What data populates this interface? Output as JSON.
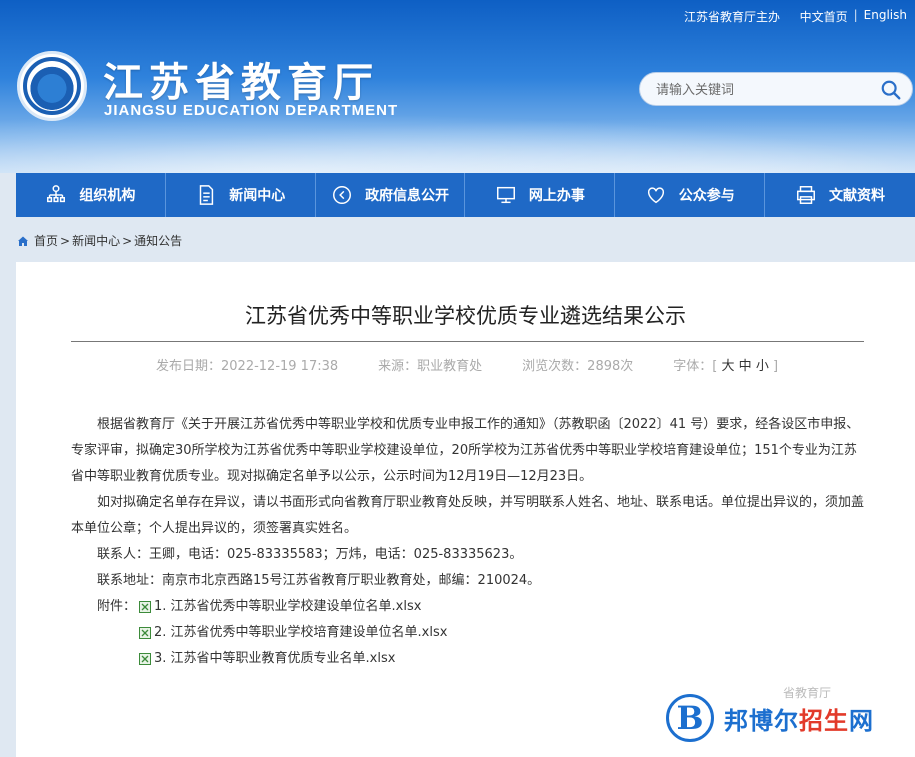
{
  "header": {
    "top_links": [
      "江苏省教育厅主办",
      "中文首页",
      "English"
    ],
    "site_name": "江苏省教育厅",
    "site_name_en": "JIANGSU EDUCATION DEPARTMENT",
    "search_placeholder": "请输入关键词"
  },
  "nav": [
    {
      "label": "组织机构",
      "icon": "org-chart-icon"
    },
    {
      "label": "新闻中心",
      "icon": "document-icon"
    },
    {
      "label": "政府信息公开",
      "icon": "info-icon"
    },
    {
      "label": "网上办事",
      "icon": "monitor-icon"
    },
    {
      "label": "公众参与",
      "icon": "heart-icon"
    },
    {
      "label": "文献资料",
      "icon": "printer-icon"
    }
  ],
  "breadcrumb": [
    "首页",
    "新闻中心",
    "通知公告"
  ],
  "article": {
    "title": "江苏省优秀中等职业学校优质专业遴选结果公示",
    "publish_date": "发布日期：2022-12-19 17:38",
    "source": "来源：职业教育处",
    "views": "浏览次数：2898次",
    "font_size_label": "字体：",
    "font_sizes": [
      "大",
      "中",
      "小"
    ],
    "para1": "根据省教育厅《关于开展江苏省优秀中等职业学校和优质专业申报工作的通知》（苏教职函〔2022〕41 号）要求，经各设区市申报、专家评审，拟确定30所学校为江苏省优秀中等职业学校建设单位，20所学校为江苏省优秀中等职业学校培育建设单位；151个专业为江苏省中等职业教育优质专业。现对拟确定名单予以公示，公示时间为12月19日—12月23日。",
    "para2": "如对拟确定名单存在异议，请以书面形式向省教育厅职业教育处反映，并写明联系人姓名、地址、联系电话。单位提出异议的，须加盖本单位公章；个人提出异议的，须签署真实姓名。",
    "contact": "联系人：王卿，电话：025-83335583；万炜，电话：025-83335623。",
    "address": "联系地址：南京市北京西路15号江苏省教育厅职业教育处，邮编：210024。",
    "attachment_label": "附件：",
    "attachments": [
      "1. 江苏省优秀中等职业学校建设单位名单.xlsx",
      "2. 江苏省优秀中等职业学校培育建设单位名单.xlsx",
      "3. 江苏省中等职业教育优质专业名单.xlsx"
    ]
  },
  "watermark": {
    "small": "省教育厅",
    "letter": "B",
    "text_a": "邦博尔",
    "text_b": "招生",
    "text_c": "网"
  }
}
